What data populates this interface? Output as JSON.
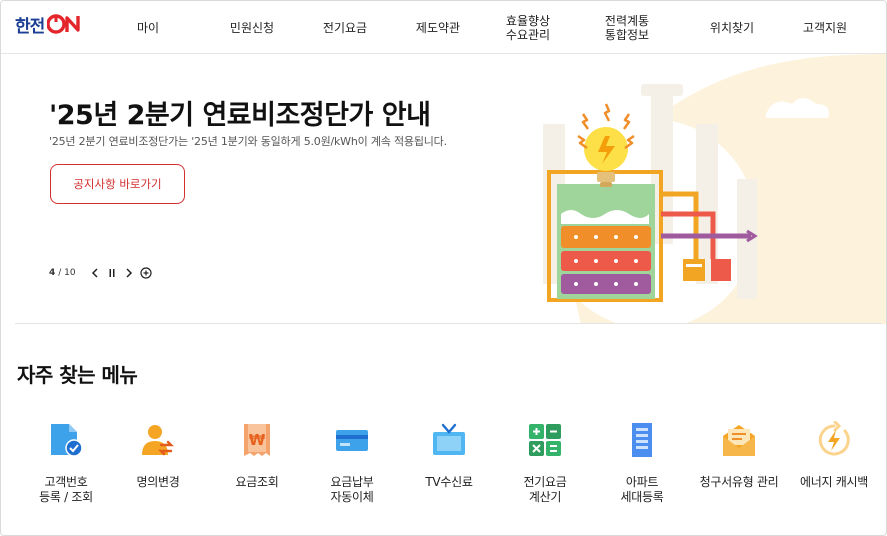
{
  "logo": {
    "text": "한전",
    "on": "ON"
  },
  "nav": {
    "items": [
      {
        "label": "마이"
      },
      {
        "label": "민원신청"
      },
      {
        "label": "전기요금"
      },
      {
        "label": "제도약관"
      },
      {
        "label": "효율향상\n수요관리"
      },
      {
        "label": "전력계통\n통합정보"
      },
      {
        "label": "위치찾기"
      },
      {
        "label": "고객지원"
      }
    ]
  },
  "hero": {
    "title": "'25년 2분기 연료비조정단가 안내",
    "subtitle": "'25년 2분기 연료비조정단가는 '25년 1분기와 동일하게 5.0원/kWh이 계속 적용됩니다.",
    "button": "공지사항 바로가기",
    "pager": {
      "current": "4",
      "total": "/ 10"
    }
  },
  "colors": {
    "brand_blue": "#1c3f95",
    "brand_red": "#e4262c",
    "accent_red": "#d32f2f",
    "hero_bg": "#fdf3dc"
  },
  "quick_menu": {
    "title": "자주 찾는 메뉴",
    "items": [
      {
        "label": "고객번호\n등록 / 조회",
        "icon": "document-check-icon"
      },
      {
        "label": "명의변경",
        "icon": "user-transfer-icon"
      },
      {
        "label": "요금조회",
        "icon": "won-receipt-icon"
      },
      {
        "label": "요금납부\n자동이체",
        "icon": "credit-card-icon"
      },
      {
        "label": "TV수신료",
        "icon": "tv-icon"
      },
      {
        "label": "전기요금\n계산기",
        "icon": "calculator-icon"
      },
      {
        "label": "아파트\n세대등록",
        "icon": "apartment-icon"
      },
      {
        "label": "청구서유형 관리",
        "icon": "mail-bill-icon"
      },
      {
        "label": "에너지 캐시백",
        "icon": "energy-cashback-icon"
      }
    ]
  }
}
